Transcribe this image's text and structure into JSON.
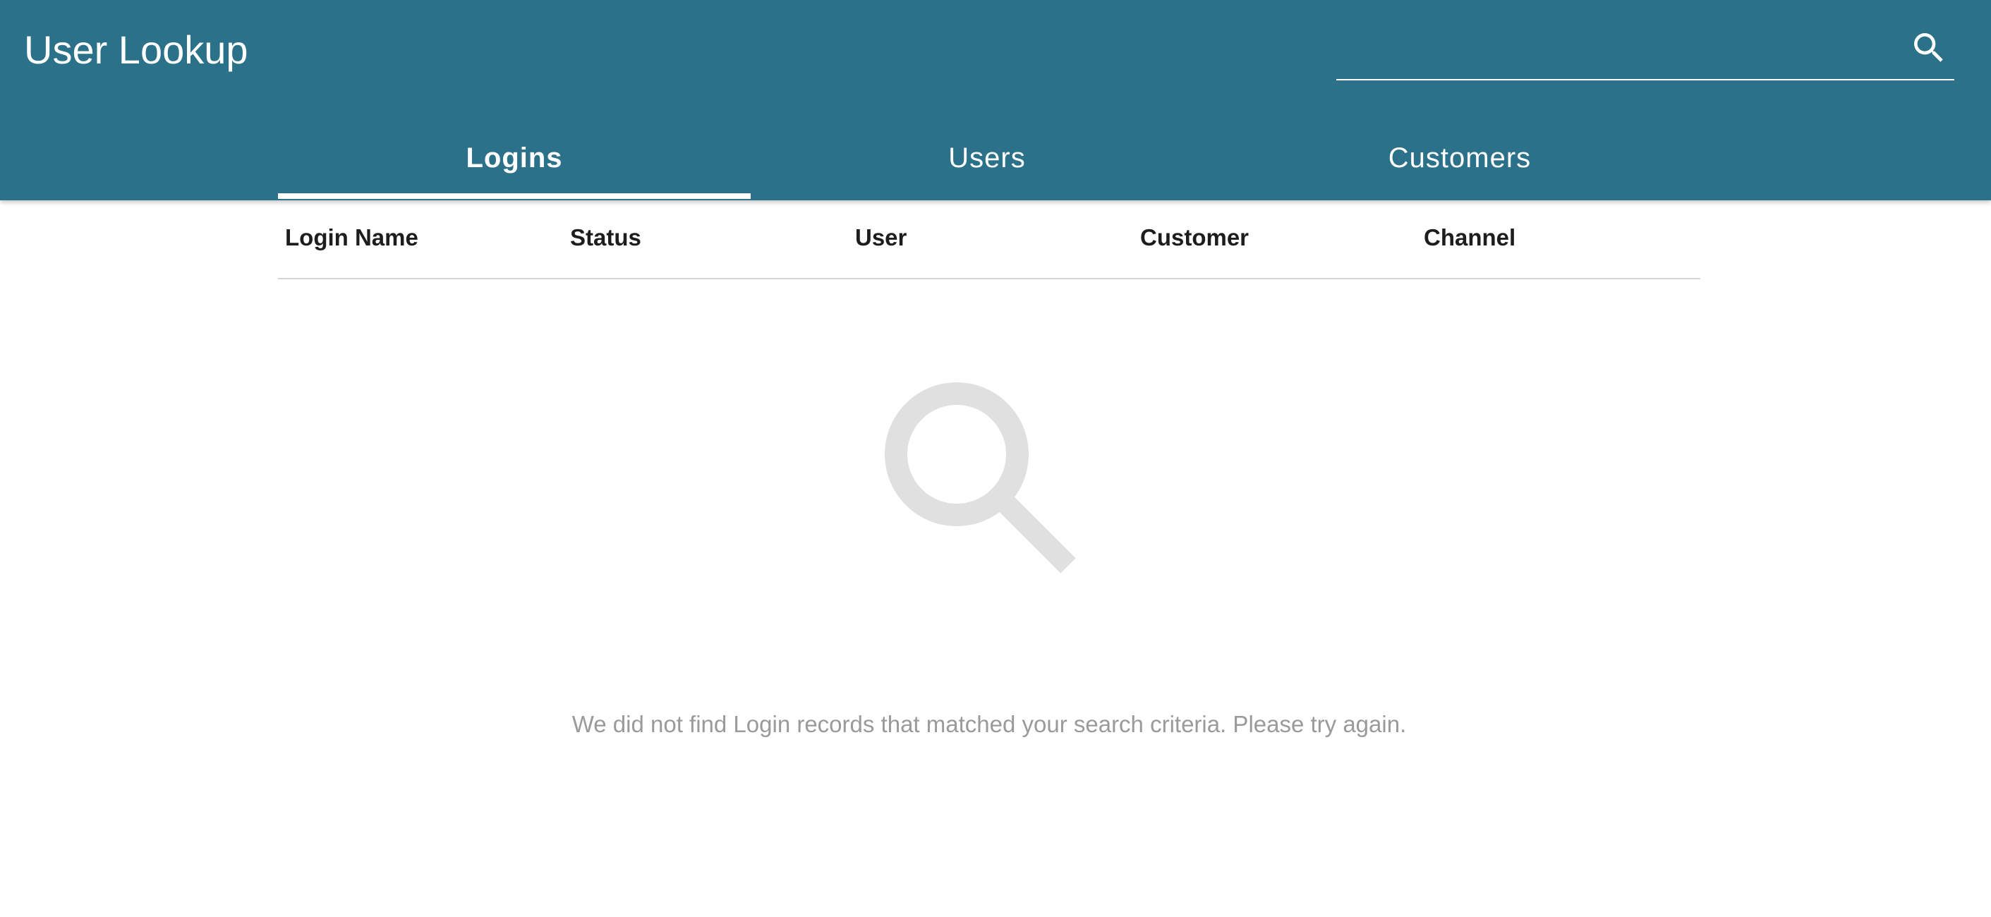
{
  "app": {
    "title": "User Lookup"
  },
  "search": {
    "value": "",
    "placeholder": "",
    "icon": "search-icon"
  },
  "tabs": [
    {
      "label": "Logins",
      "active": true
    },
    {
      "label": "Users",
      "active": false
    },
    {
      "label": "Customers",
      "active": false
    }
  ],
  "table": {
    "columns": [
      "Login Name",
      "Status",
      "User",
      "Customer",
      "Channel"
    ],
    "rows": []
  },
  "empty_state": {
    "icon": "search-icon",
    "message": "We did not find Login records that matched your search criteria. Please try again."
  },
  "colors": {
    "header_background": "#2b7189",
    "header_text": "#ffffff",
    "empty_icon": "#e0e0e0",
    "empty_text": "#9a9a9a"
  }
}
